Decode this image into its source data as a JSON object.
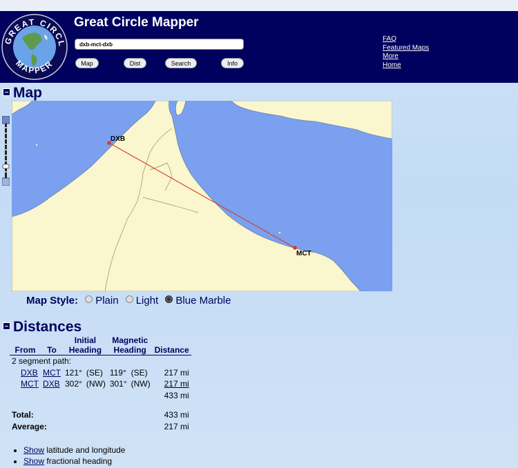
{
  "header": {
    "title": "Great Circle Mapper",
    "search_value": "dxb-mct-dxb",
    "logo_text": "GREAT CIRCLE MAPPER",
    "buttons": [
      "Map",
      "Dist",
      "Search",
      "Info"
    ],
    "links": [
      "FAQ",
      "Featured Maps",
      "More",
      "Home"
    ]
  },
  "map_section": {
    "heading": "Map",
    "airports": [
      {
        "code": "DXB"
      },
      {
        "code": "MCT"
      }
    ],
    "colors": {
      "water": "#7aa0ef",
      "land": "#faf6cd",
      "route": "#d23b2b"
    },
    "map_style": {
      "label": "Map Style:",
      "options": [
        "Plain",
        "Light",
        "Blue Marble"
      ],
      "selected": "Blue Marble"
    }
  },
  "distances_section": {
    "heading": "Distances",
    "columns": [
      "From",
      "To",
      "Initial Heading",
      "Magnetic Heading",
      "Distance"
    ],
    "column_top": {
      "initial": "Initial",
      "magnetic": "Magnetic"
    },
    "column_bottom": {
      "initial": "Heading",
      "magnetic": "Heading"
    },
    "segment_label": "2 segment path:",
    "rows": [
      {
        "from": "DXB",
        "to": "MCT",
        "initial_deg": "121°",
        "initial_dir": "(SE)",
        "mag_deg": "119°",
        "mag_dir": "(SE)",
        "distance": "217 mi"
      },
      {
        "from": "MCT",
        "to": "DXB",
        "initial_deg": "302°",
        "initial_dir": "(NW)",
        "mag_deg": "301°",
        "mag_dir": "(NW)",
        "distance": "217 mi"
      }
    ],
    "subtotal": "433 mi",
    "total_label": "Total:",
    "total_value": "433 mi",
    "average_label": "Average:",
    "average_value": "217 mi",
    "options": [
      {
        "link": "Show",
        "text": " latitude and longitude"
      },
      {
        "link": "Show",
        "text": " fractional heading"
      }
    ]
  }
}
